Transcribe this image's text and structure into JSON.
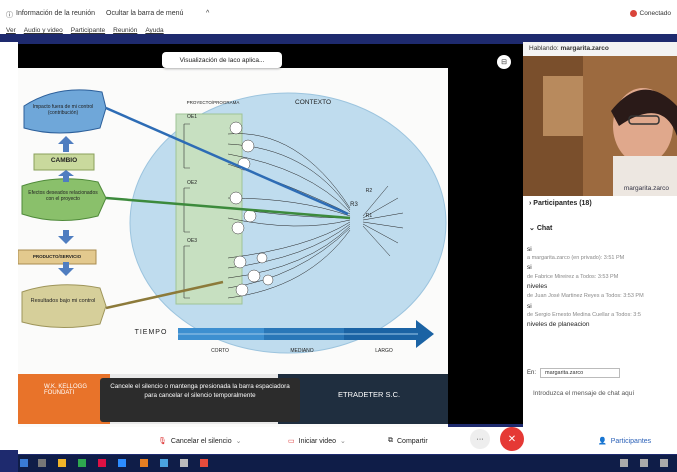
{
  "titlebar": {
    "info": "Información de la reunión",
    "hide_menu": "Ocultar la barra de menú",
    "status": "Conectado"
  },
  "menu": [
    "Ver",
    "Audio y video",
    "Participante",
    "Reunión",
    "Ayuda"
  ],
  "share": {
    "banner": "Visualización de laco aplica...",
    "slide": {
      "proyecto": "PROYECTO/PROGRAMA",
      "contexto": "CONTEXTO",
      "box1": "Impacto fuera de mi control (contribución)",
      "cambio": "CAMBIO",
      "box2": "Efectos deseados relacionados con el proyecto",
      "producto": "PRODUCTO/SERVICIO",
      "box3": "Resultados bajo mi control",
      "tiempo": "TIEMPO",
      "corto": "CORTO",
      "mediano": "MEDIANO",
      "largo": "LARGO",
      "oe1": "OE1",
      "oe2": "OE2",
      "oe3": "OE3",
      "r3": "R3",
      "r2": "R2",
      "r1": "R1",
      "kellogg": "W.K. KELLOGG FOUNDATI",
      "etradeter": "ETRADETER S.C."
    }
  },
  "tooltip": "Cancele el silencio o mantenga presionada la barra espaciadora para cancelar el silencio temporalmente",
  "panel": {
    "speaking_label": "Hablando:",
    "speaker": "margarita.zarco",
    "video_name": "margarita.zarco",
    "participants": "Participantes (18)",
    "chat": "Chat",
    "chat_lines": [
      {
        "kind": "msg",
        "text": "si"
      },
      {
        "kind": "meta",
        "text": "a margarita.zarco (en privado):  3:51 PM"
      },
      {
        "kind": "msg",
        "text": "si"
      },
      {
        "kind": "meta",
        "text": "de Fabrice Mireirez a Todos:  3:53 PM"
      },
      {
        "kind": "msg",
        "text": "niveles"
      },
      {
        "kind": "meta",
        "text": "de Juan José Martinez Reyes a Todos:  3:53 PM"
      },
      {
        "kind": "msg",
        "text": "si"
      },
      {
        "kind": "meta",
        "text": "de Sergio Ernesto Medina Cuellar a Todos:  3:5"
      },
      {
        "kind": "msg",
        "text": "niveles de planeacion"
      }
    ],
    "en_label": "En:",
    "en_value": "margarita.zarco",
    "input_placeholder": "Introduzca el mensaje de chat aquí"
  },
  "toolbar": {
    "unmute": "Cancelar el silencio",
    "video": "Iniciar video",
    "share": "Compartir",
    "more": "···",
    "participants": "Participantes"
  },
  "colors": {
    "brand_blue": "#1e2a6e",
    "hangup": "#e53935"
  }
}
